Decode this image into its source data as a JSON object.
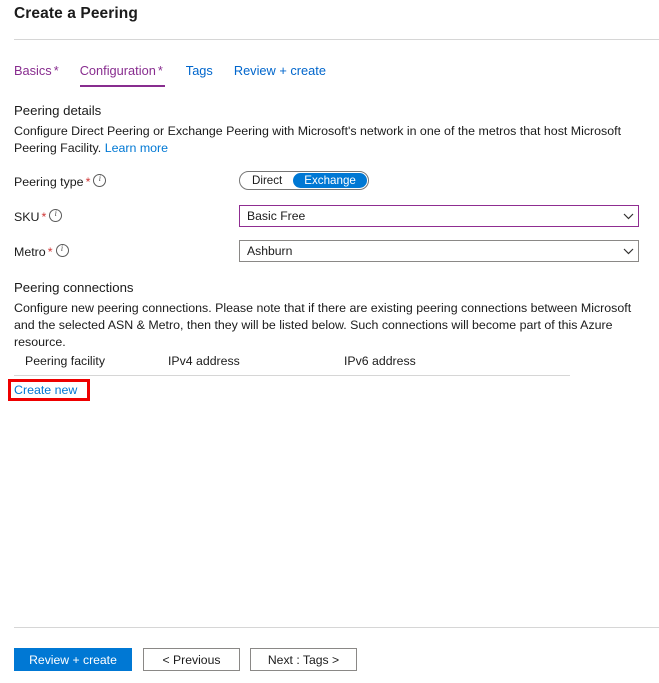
{
  "header": {
    "title": "Create a Peering"
  },
  "tabs": [
    {
      "label": "Basics",
      "required": "*",
      "state": "visited",
      "active": false
    },
    {
      "label": "Configuration",
      "required": "*",
      "state": "visited",
      "active": true
    },
    {
      "label": "Tags",
      "required": "",
      "state": "link",
      "active": false
    },
    {
      "label": "Review + create",
      "required": "",
      "state": "link",
      "active": false
    }
  ],
  "peering_details": {
    "heading": "Peering details",
    "description_line1": "Configure Direct Peering or Exchange Peering with Microsoft's network in one of the metros that host Microsoft",
    "description_line2": "Peering Facility.",
    "learn_more": "Learn more"
  },
  "fields": {
    "peering_type": {
      "label": "Peering type",
      "required": "*",
      "options": [
        "Direct",
        "Exchange"
      ],
      "selected": "Exchange"
    },
    "sku": {
      "label": "SKU",
      "required": "*",
      "value": "Basic Free",
      "focused": true
    },
    "metro": {
      "label": "Metro",
      "required": "*",
      "value": "Ashburn",
      "focused": false
    }
  },
  "peering_connections": {
    "heading": "Peering connections",
    "description_line1": "Configure new peering connections. Please note that if there are existing peering connections between Microsoft and",
    "description_line2": "the selected ASN & Metro, then they will be listed below. Such connections will become part of this Azure resource.",
    "columns": [
      "Peering facility",
      "IPv4 address",
      "IPv6 address"
    ],
    "rows": [],
    "create_new": "Create new"
  },
  "footer": {
    "review_create": "Review + create",
    "previous": "< Previous",
    "next": "Next : Tags >"
  },
  "colors": {
    "accent_blue": "#0078d4",
    "link_blue": "#0066cc",
    "visited_purple": "#882d8f",
    "focus_purple": "#8f2d91",
    "required_red": "#cf3434",
    "highlight_red": "#ee0000"
  }
}
